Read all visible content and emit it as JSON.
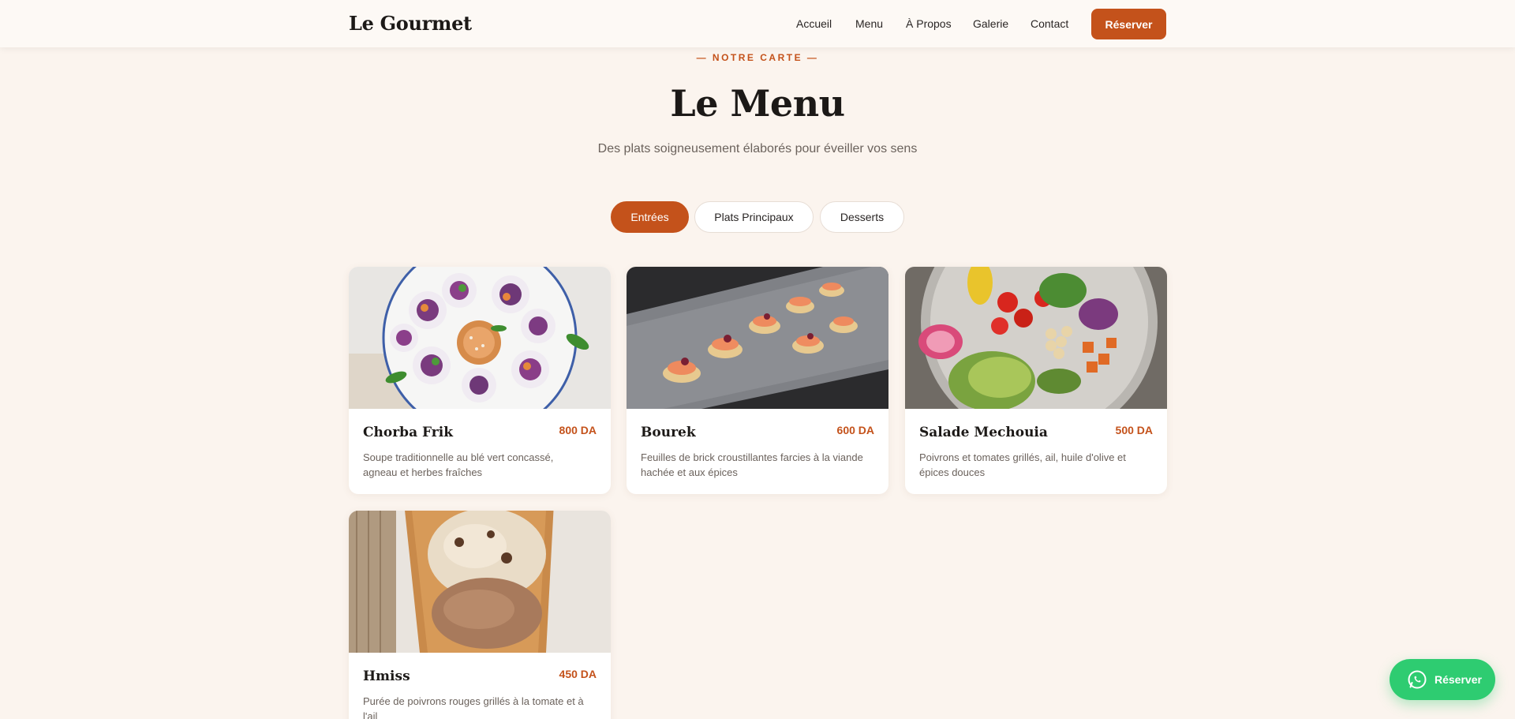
{
  "brand": "Le Gourmet",
  "nav": [
    "Accueil",
    "Menu",
    "À Propos",
    "Galerie",
    "Contact"
  ],
  "header_cta": "Réserver",
  "eyebrow": "— NOTRE CARTE —",
  "title": "Le Menu",
  "subtitle": "Des plats soigneusement élaborés pour éveiller vos sens",
  "tabs": [
    "Entrées",
    "Plats Principaux",
    "Desserts"
  ],
  "active_tab": "Entrées",
  "dishes": [
    {
      "name": "Chorba Frik",
      "price": "800 DA",
      "description": "Soupe traditionnelle au blé vert concassé, agneau et herbes fraîches",
      "image": "spring-rolls-photo"
    },
    {
      "name": "Bourek",
      "price": "600 DA",
      "description": "Feuilles de brick croustillantes farcies à la viande hachée et aux épices",
      "image": "salmon-canapes-photo"
    },
    {
      "name": "Salade Mechouia",
      "price": "500 DA",
      "description": "Poivrons et tomates grillés, ail, huile d'olive et épices douces",
      "image": "salad-bowl-photo"
    },
    {
      "name": "Hmiss",
      "price": "450 DA",
      "description": "Purée de poivrons rouges grillés à la tomate et à l'ail",
      "image": "ice-cream-cone-photo"
    }
  ],
  "whatsapp_label": "Réserver",
  "colors": {
    "accent": "#c4521b",
    "background": "#fbf4ee",
    "whatsapp": "#2ecc71"
  }
}
